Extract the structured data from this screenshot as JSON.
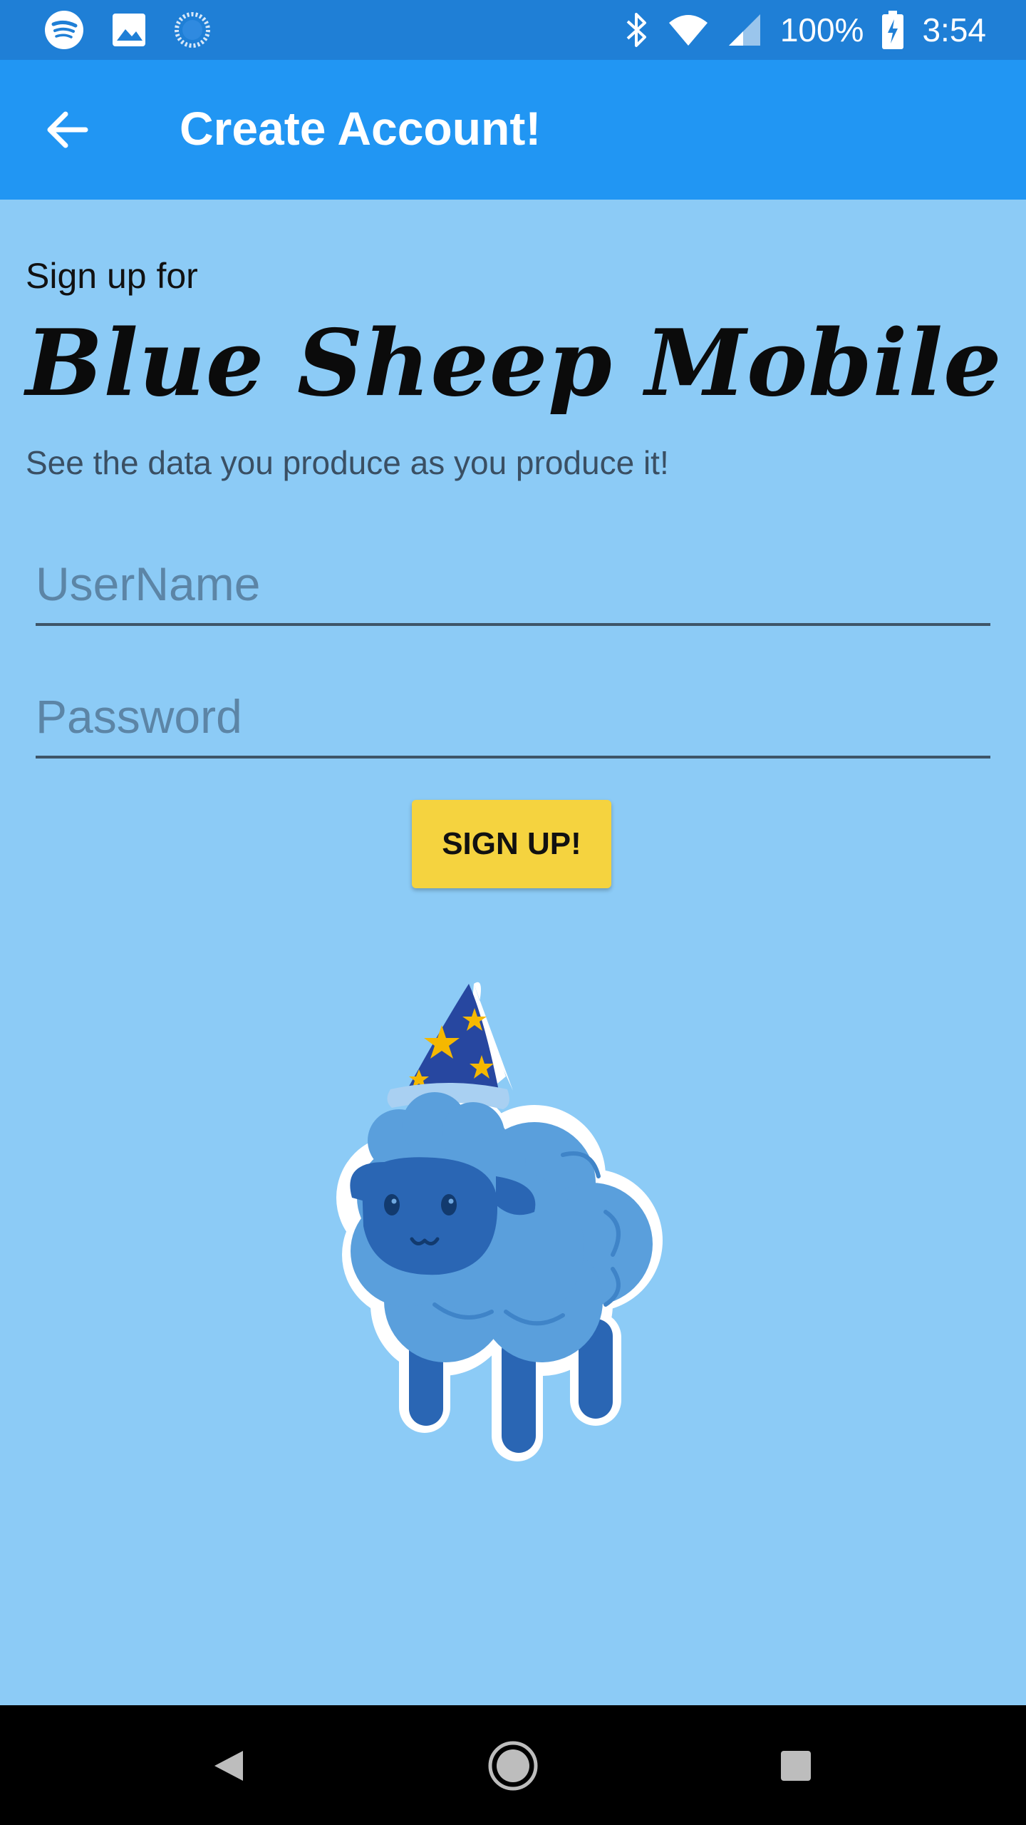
{
  "status_bar": {
    "icons": [
      "spotify-icon",
      "image-icon",
      "loading-icon",
      "bluetooth-icon",
      "wifi-icon",
      "cell-signal-icon",
      "battery-charging-icon"
    ],
    "battery": "100%",
    "time": "3:54"
  },
  "app_bar": {
    "title": "Create Account!",
    "back_icon": "arrow-back-icon"
  },
  "content": {
    "intro": "Sign up for",
    "brand": "Blue Sheep Mobile",
    "tagline": "See the data you produce as you produce it!",
    "username_placeholder": "UserName",
    "password_placeholder": "Password",
    "signup_label": "SIGN UP!"
  },
  "nav_bar": {
    "icons": [
      "nav-back-icon",
      "nav-home-icon",
      "nav-recents-icon"
    ]
  },
  "colors": {
    "status_bar": "#1f7fd6",
    "app_bar": "#2196f3",
    "background": "#8ccbf6",
    "button": "#f5d33f",
    "sheep_wool": "#5a9fdc",
    "sheep_face": "#2a66b4"
  }
}
